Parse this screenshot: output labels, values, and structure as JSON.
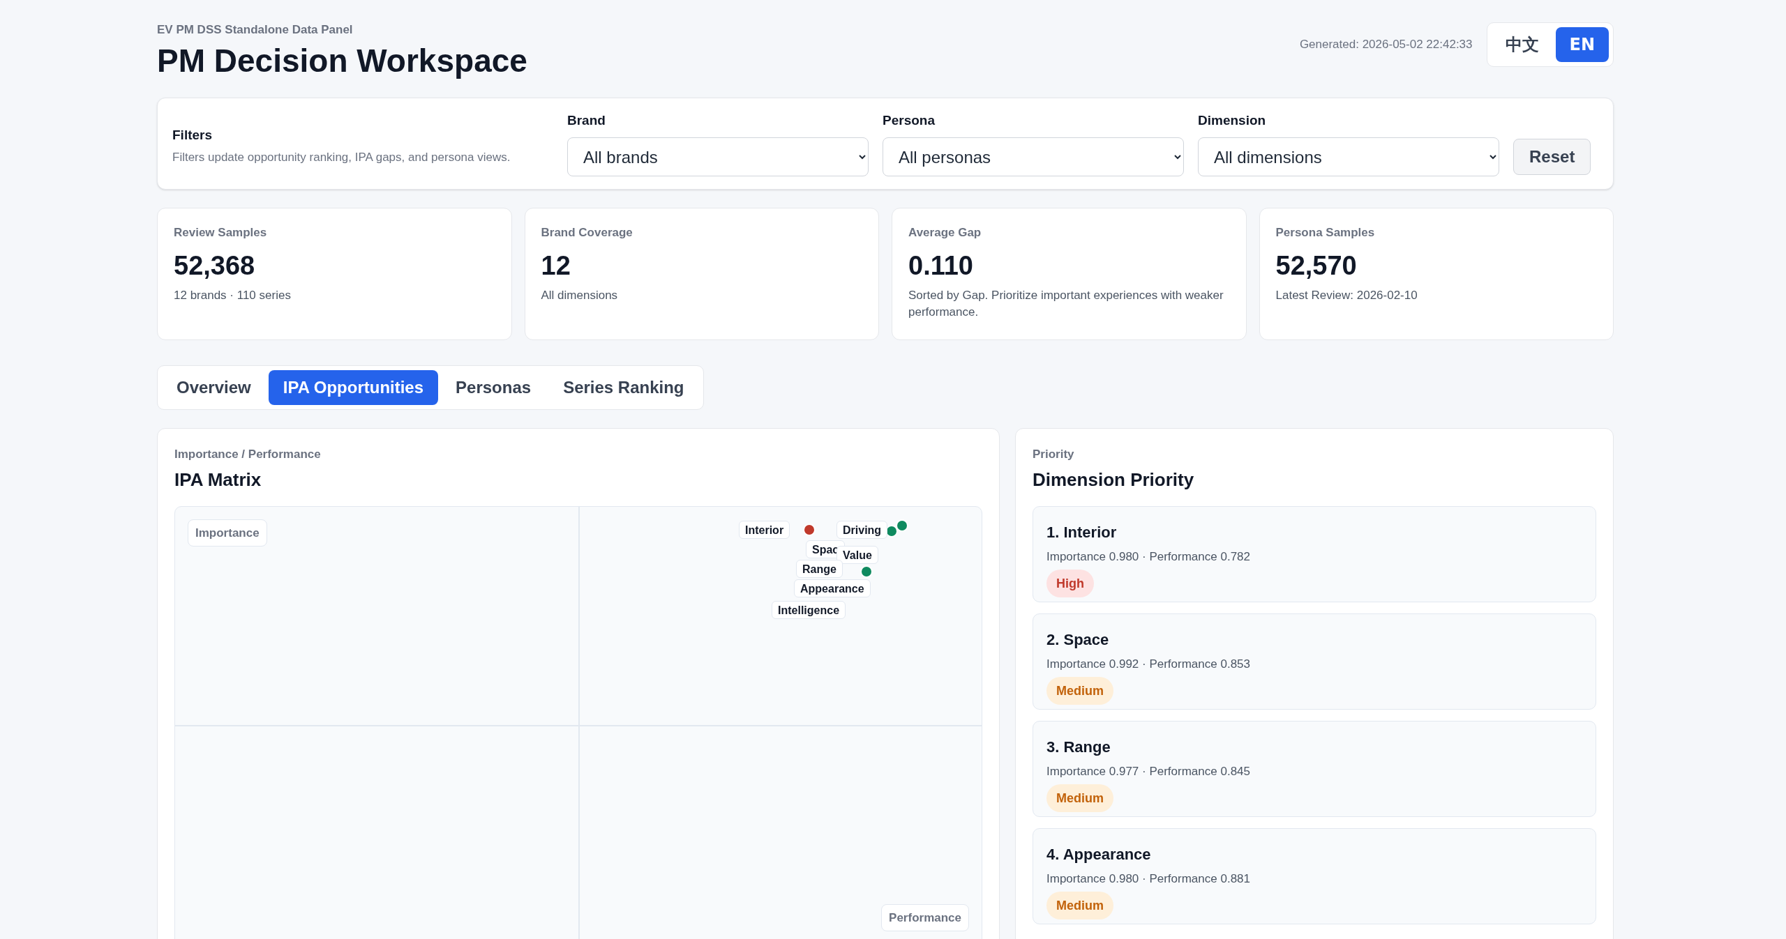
{
  "header": {
    "eyebrow": "EV PM DSS Standalone Data Panel",
    "title": "PM Decision Workspace",
    "generated": "Generated: 2026-05-02 22:42:33",
    "languages": [
      {
        "label": "中文",
        "selected": false
      },
      {
        "label": "EN",
        "selected": true
      }
    ]
  },
  "filters": {
    "title": "Filters",
    "description": "Filters update opportunity ranking, IPA gaps, and persona views.",
    "fields": [
      {
        "label": "Brand",
        "value": "All brands"
      },
      {
        "label": "Persona",
        "value": "All personas"
      },
      {
        "label": "Dimension",
        "value": "All dimensions"
      }
    ],
    "reset": "Reset"
  },
  "stats": [
    {
      "label": "Review Samples",
      "value": "52,368",
      "note": "12 brands · 110 series"
    },
    {
      "label": "Brand Coverage",
      "value": "12",
      "note": "All dimensions"
    },
    {
      "label": "Average Gap",
      "value": "0.110",
      "note": "Sorted by Gap. Prioritize important experiences with weaker performance."
    },
    {
      "label": "Persona Samples",
      "value": "52,570",
      "note": "Latest Review: 2026-02-10"
    }
  ],
  "tabs": [
    {
      "label": "Overview",
      "selected": false
    },
    {
      "label": "IPA Opportunities",
      "selected": true
    },
    {
      "label": "Personas",
      "selected": false
    },
    {
      "label": "Series Ranking",
      "selected": false
    }
  ],
  "ipa": {
    "subtitle": "Importance / Performance",
    "title": "IPA Matrix",
    "y_axis": "Importance",
    "x_axis": "Performance",
    "labels": [
      "Interior",
      "Driving",
      "Spac",
      "Value",
      "Range",
      "Appearance",
      "Intelligence"
    ],
    "dots": [
      {
        "color": "#c0392b"
      },
      {
        "color": "#0f8a5f"
      },
      {
        "color": "#0f8a5f"
      },
      {
        "color": "#0f8a5f"
      }
    ]
  },
  "priority": {
    "subtitle": "Priority",
    "title": "Dimension Priority",
    "items": [
      {
        "title": "1. Interior",
        "meta": "Importance 0.980 · Performance 0.782",
        "badge": {
          "label": "High",
          "kind": "high"
        }
      },
      {
        "title": "2. Space",
        "meta": "Importance 0.992 · Performance 0.853",
        "badge": {
          "label": "Medium",
          "kind": "medium"
        }
      },
      {
        "title": "3. Range",
        "meta": "Importance 0.977 · Performance 0.845",
        "badge": {
          "label": "Medium",
          "kind": "medium"
        }
      },
      {
        "title": "4. Appearance",
        "meta": "Importance 0.980 · Performance 0.881",
        "badge": {
          "label": "Medium",
          "kind": "medium"
        }
      }
    ]
  }
}
